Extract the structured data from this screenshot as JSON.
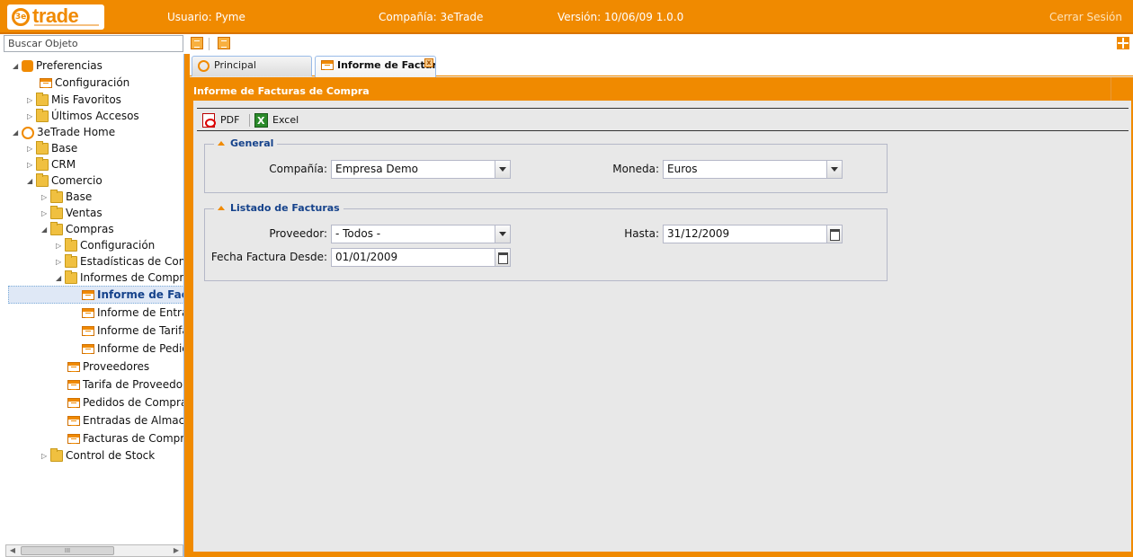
{
  "header": {
    "logo_text": "trade",
    "logo_badge": "3e",
    "usuario": "Usuario: Pyme",
    "compania": "Compañía: 3eTrade",
    "version": "Versión: 10/06/09 1.0.0",
    "logout": "Cerrar Sesión"
  },
  "search": {
    "placeholder": "Buscar Objeto"
  },
  "tree": {
    "items": [
      {
        "label": "Preferencias"
      },
      {
        "label": "Configuración"
      },
      {
        "label": "Mis Favoritos"
      },
      {
        "label": "Últimos Accesos"
      },
      {
        "label": "3eTrade Home"
      },
      {
        "label": "Base"
      },
      {
        "label": "CRM"
      },
      {
        "label": "Comercio"
      },
      {
        "label": "Base"
      },
      {
        "label": "Ventas"
      },
      {
        "label": "Compras"
      },
      {
        "label": "Configuración"
      },
      {
        "label": "Estadísticas de Compras"
      },
      {
        "label": "Informes de Compras"
      },
      {
        "label": "Informe de Facturas de Compra"
      },
      {
        "label": "Informe de Entradas"
      },
      {
        "label": "Informe de Tarifas"
      },
      {
        "label": "Informe de Pedidos"
      },
      {
        "label": "Proveedores"
      },
      {
        "label": "Tarifa de Proveedores"
      },
      {
        "label": "Pedidos de Compra"
      },
      {
        "label": "Entradas de Almacén"
      },
      {
        "label": "Facturas de Compra"
      },
      {
        "label": "Control de Stock"
      }
    ],
    "scroll_thumb": "III"
  },
  "tabs": [
    {
      "label": "Principal"
    },
    {
      "label": "Informe de Facturas de Compra",
      "close": "x"
    }
  ],
  "panel": {
    "title": "Informe de Facturas de Compra",
    "toolbar": {
      "pdf": "PDF",
      "excel": "Excel"
    },
    "general": {
      "legend": "General",
      "compania_label": "Compañía:",
      "compania_value": "Empresa Demo",
      "moneda_label": "Moneda:",
      "moneda_value": "Euros"
    },
    "listado": {
      "legend": "Listado de Facturas",
      "proveedor_label": "Proveedor:",
      "proveedor_value": "- Todos -",
      "hasta_label": "Hasta:",
      "hasta_value": "31/12/2009",
      "desde_label": "Fecha Factura Desde:",
      "desde_value": "01/01/2009"
    }
  },
  "colors": {
    "accent": "#f08a00",
    "selection": "#dfe8f6",
    "legend_text": "#15428b"
  }
}
